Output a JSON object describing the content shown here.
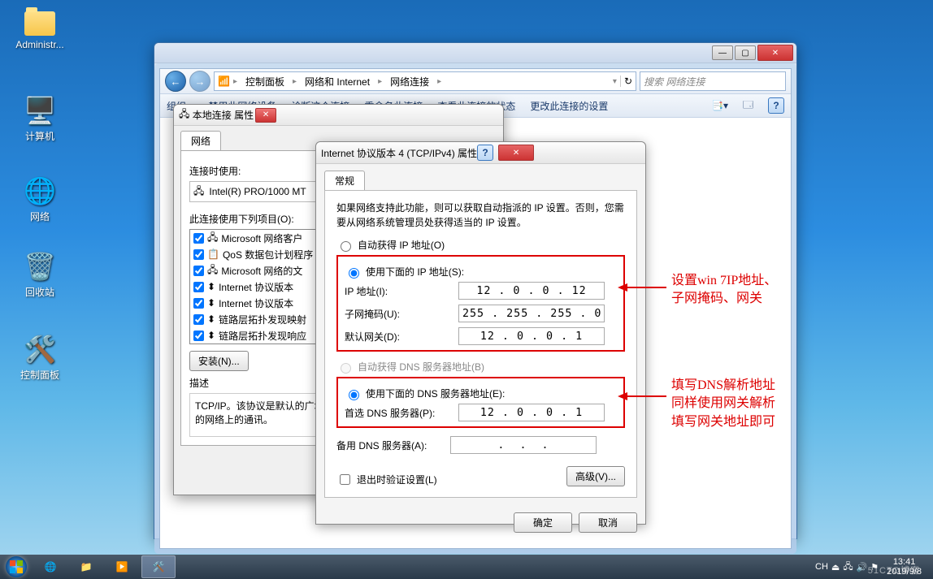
{
  "desktop_icons": [
    {
      "label": "Administr...",
      "glyph": "folder"
    },
    {
      "label": "计算机",
      "glyph": "🖥️"
    },
    {
      "label": "网络",
      "glyph": "🖧"
    },
    {
      "label": "回收站",
      "glyph": "🗑️"
    },
    {
      "label": "控制面板",
      "glyph": "⚙️"
    }
  ],
  "cp": {
    "breadcrumb": [
      "控制面板",
      "网络和 Internet",
      "网络连接"
    ],
    "search_placeholder": "搜索 网络连接",
    "toolbar": [
      "组织 ▾",
      "禁用此网络设备",
      "诊断这个连接",
      "重命名此连接",
      "查看此连接的状态",
      "更改此连接的设置"
    ]
  },
  "prop": {
    "title": "本地连接 属性",
    "tab": "网络",
    "connect_label": "连接时使用:",
    "adapter": "Intel(R) PRO/1000 MT",
    "items_label": "此连接使用下列项目(O):",
    "items": [
      {
        "c": true,
        "t": "Microsoft 网络客户"
      },
      {
        "c": true,
        "t": "QoS 数据包计划程序"
      },
      {
        "c": true,
        "t": "Microsoft 网络的文"
      },
      {
        "c": true,
        "t": "Internet 协议版本"
      },
      {
        "c": true,
        "t": "Internet 协议版本"
      },
      {
        "c": true,
        "t": "链路层拓扑发现映射"
      },
      {
        "c": true,
        "t": "链路层拓扑发现响应"
      }
    ],
    "install": "安装(N)...",
    "desc_label": "描述",
    "desc": "TCP/IP。该协议是默认的广域网络协议，它提供在不同的相互连接的网络上的通讯。"
  },
  "ipv4": {
    "title": "Internet 协议版本 4 (TCP/IPv4) 属性",
    "tab": "常规",
    "hint": "如果网络支持此功能，则可以获取自动指派的 IP 设置。否则，您需要从网络系统管理员处获得适当的 IP 设置。",
    "auto_ip": "自动获得 IP 地址(O)",
    "use_ip": "使用下面的 IP 地址(S):",
    "ip_label": "IP 地址(I):",
    "ip_value": "12 . 0 . 0 . 12",
    "mask_label": "子网掩码(U):",
    "mask_value": "255 . 255 . 255 . 0",
    "gw_label": "默认网关(D):",
    "gw_value": "12 . 0 . 0 . 1",
    "auto_dns": "自动获得 DNS 服务器地址(B)",
    "use_dns": "使用下面的 DNS 服务器地址(E):",
    "pref_dns_label": "首选 DNS 服务器(P):",
    "pref_dns_value": "12 . 0 . 0 . 1",
    "alt_dns_label": "备用 DNS 服务器(A):",
    "alt_dns_value": " .  .  . ",
    "validate": "退出时验证设置(L)",
    "advanced": "高级(V)...",
    "ok": "确定",
    "cancel": "取消"
  },
  "annotations": {
    "a1": "设置win 7IP地址、\n子网掩码、网关",
    "a2": "填写DNS解析地址\n同样使用网关解析\n填写网关地址即可"
  },
  "tray": {
    "ime": "CH",
    "time": "13:41",
    "date": "2019/9/8"
  },
  "watermark": "51CTO博客"
}
